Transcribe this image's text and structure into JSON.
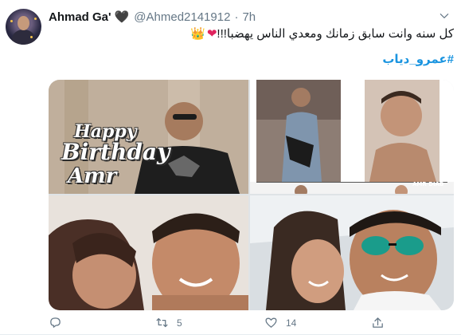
{
  "tweet": {
    "display_name": "Ahmad Ga'",
    "name_emoji": "🖤",
    "handle": "@Ahmed2141912",
    "separator": "·",
    "time": "7h",
    "text": "كل سنه وانت سابق زمانك ومعدي الناس يهضبا!!!",
    "emoji_heart": "❤",
    "emoji_crown": "👑",
    "hashtag": "#عمرو_دياب",
    "media_overlay_line1": "Happy",
    "media_overlay_line2": "Birthday",
    "media_overlay_line3": "Amr",
    "watermark": "AMR DIAB"
  },
  "actions": {
    "reply_count": "",
    "retweet_count": "5",
    "like_count": "14",
    "share_count": ""
  },
  "colors": {
    "accent": "#1b95e0",
    "muted": "#657786",
    "heart": "#e0245e"
  },
  "icons": [
    "caret-down-icon",
    "reply-icon",
    "retweet-icon",
    "like-icon",
    "share-icon"
  ]
}
